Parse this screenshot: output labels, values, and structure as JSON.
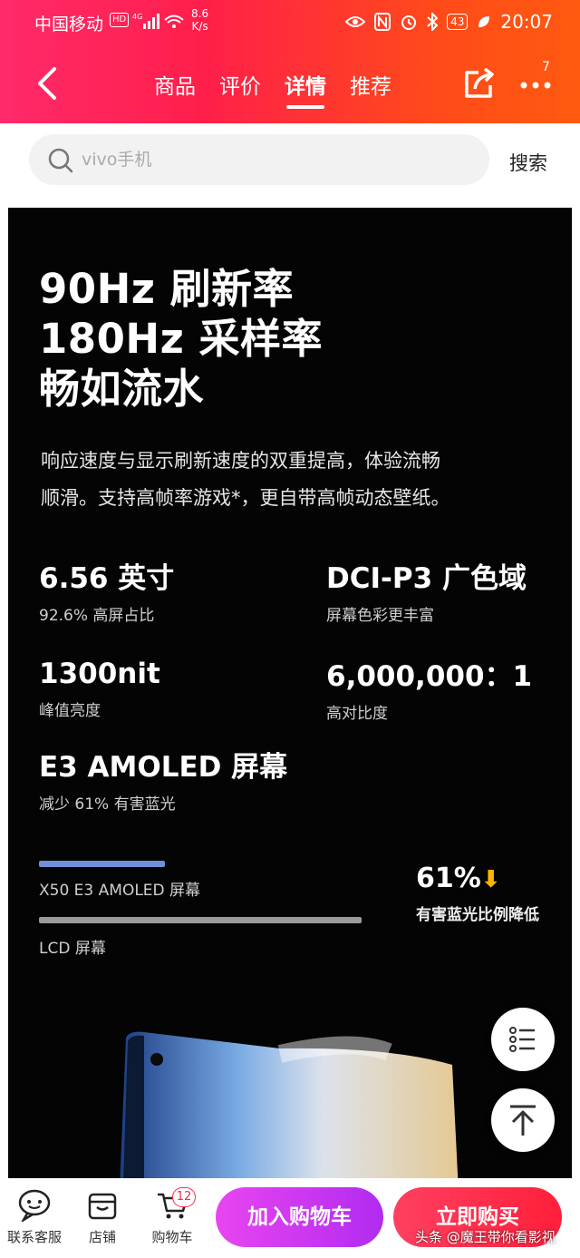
{
  "status": {
    "carrier": "中国移动",
    "hd": "HD",
    "net_speed_value": "8.6",
    "net_speed_unit": "K/s",
    "battery": "43",
    "time": "20:07"
  },
  "nav": {
    "tabs": [
      {
        "label": "商品"
      },
      {
        "label": "评价"
      },
      {
        "label": "详情",
        "active": true
      },
      {
        "label": "推荐"
      }
    ],
    "more_badge": "7"
  },
  "search": {
    "placeholder": "vivo手机",
    "button_label": "搜索"
  },
  "detail": {
    "headline": [
      "90Hz 刷新率",
      "180Hz 采样率",
      "畅如流水"
    ],
    "description": [
      "响应速度与显示刷新速度的双重提高，体验流畅",
      "顺滑。支持高帧率游戏*，更自带高帧动态壁纸。"
    ],
    "specs": [
      {
        "value": "6.56 英寸",
        "caption": "92.6% 高屏占比"
      },
      {
        "value": "DCI-P3 广色域",
        "caption": "屏幕色彩更丰富"
      },
      {
        "value": "1300nit",
        "caption": "峰值亮度"
      },
      {
        "value": "6,000,000：1",
        "caption": "高对比度"
      },
      {
        "value": "E3 AMOLED 屏幕",
        "caption": "减少 61% 有害蓝光"
      }
    ],
    "comparison": {
      "bars": [
        {
          "label": "X50  E3 AMOLED 屏幕",
          "level": 39,
          "color": "#6f8fd8"
        },
        {
          "label": "LCD 屏幕",
          "level": 100,
          "color": "#9a9a9a"
        }
      ],
      "percent": "61%",
      "arrow": "⬇",
      "percent_label": "有害蓝光比例降低"
    }
  },
  "bottom_bar": {
    "service_label": "联系客服",
    "store_label": "店铺",
    "cart_label": "购物车",
    "cart_count": "12",
    "add_to_cart": "加入购物车",
    "buy_now": "立即购买"
  },
  "watermark": "头条 @魔王带你看影视"
}
